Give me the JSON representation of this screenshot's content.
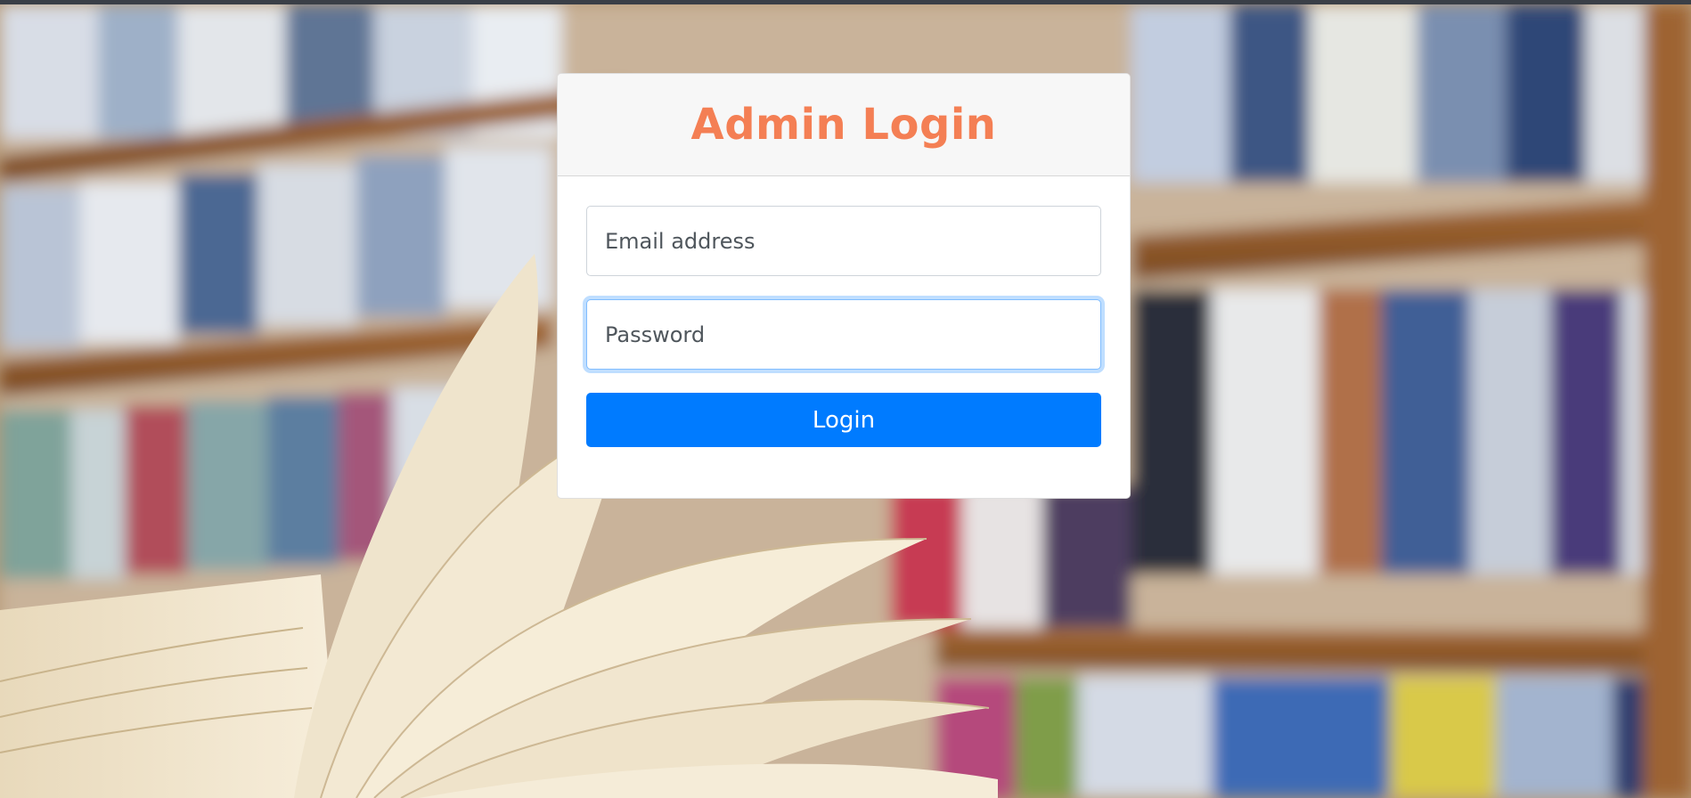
{
  "login": {
    "title": "Admin Login",
    "email_placeholder": "Email address",
    "email_value": "",
    "password_placeholder": "Password",
    "password_value": "",
    "submit_label": "Login"
  },
  "colors": {
    "title": "#f47f54",
    "button": "#007bff",
    "focus_ring": "#80bdff"
  },
  "background": {
    "description_icon": "library-bookshelf-open-book-photo"
  }
}
